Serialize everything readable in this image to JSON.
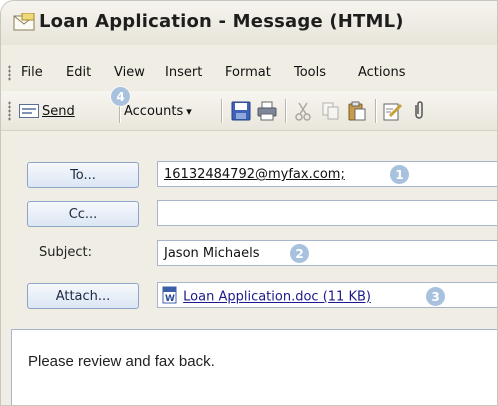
{
  "window": {
    "title": "Loan Application - Message (HTML)"
  },
  "menu": {
    "items": [
      {
        "label": "File"
      },
      {
        "label": "Edit"
      },
      {
        "label": "View"
      },
      {
        "label": "Insert"
      },
      {
        "label": "Format"
      },
      {
        "label": "Tools"
      },
      {
        "label": "Actions"
      }
    ]
  },
  "toolbar": {
    "send_label": "Send",
    "accounts_label": "Accounts",
    "accounts_arrow": "▾",
    "icons": [
      "envelope-icon",
      "save-icon",
      "print-icon",
      "cut-icon",
      "copy-icon",
      "paste-icon",
      "edit-icon",
      "attach-icon"
    ]
  },
  "fields": {
    "to": {
      "button_label": "To...",
      "value": "16132484792@myfax.com;"
    },
    "cc": {
      "button_label": "Cc...",
      "value": ""
    },
    "subject": {
      "label": "Subject:",
      "value": "Jason Michaels"
    },
    "attach": {
      "button_label": "Attach...",
      "value": "Loan Application.doc (11 KB)"
    }
  },
  "body": {
    "text": "Please review and fax back."
  },
  "callouts": {
    "one": "1",
    "two": "2",
    "three": "3",
    "four": "4"
  },
  "colors": {
    "window_bg": "#f0ede4",
    "button_border": "#8fa5c6",
    "callout_badge": "#a8c2de",
    "link": "#1a1a8c"
  }
}
